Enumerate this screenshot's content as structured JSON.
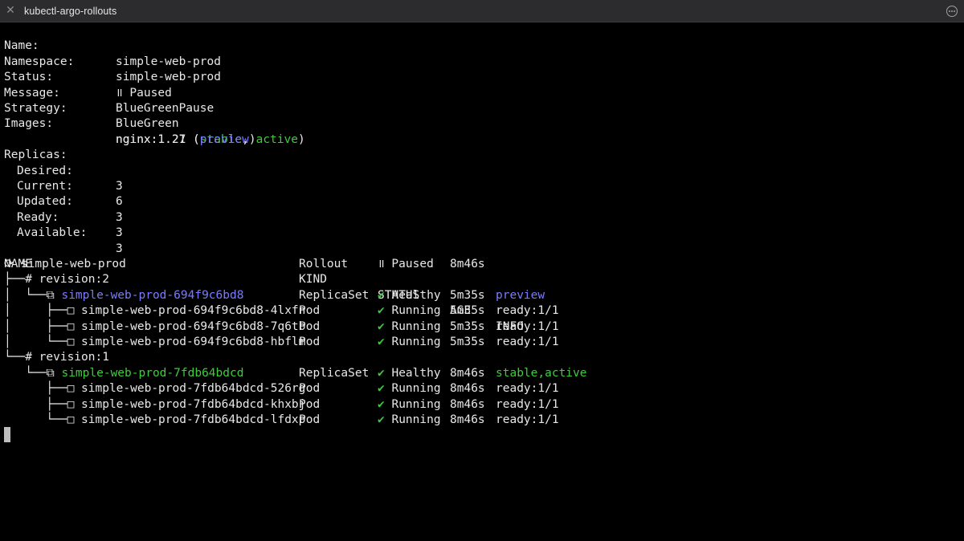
{
  "window": {
    "title": "kubectl-argo-rollouts"
  },
  "summary": {
    "name_label": "Name:",
    "name_value": "simple-web-prod",
    "namespace_label": "Namespace:",
    "namespace_value": "simple-web-prod",
    "status_label": "Status:",
    "status_value": "॥ Paused",
    "message_label": "Message:",
    "message_value": "BlueGreenPause",
    "strategy_label": "Strategy:",
    "strategy_value": "BlueGreen",
    "images_label": "Images:",
    "image1_name": "nginx:1.21",
    "image1_open": " (",
    "image1_tag_stable": "stable",
    "image1_sep": ", ",
    "image1_tag_active": "active",
    "image1_close": ")",
    "image2_name": "nginx:1.27",
    "image2_open": " (",
    "image2_tag_preview": "preview",
    "image2_close": ")"
  },
  "replicas": {
    "label": "Replicas:",
    "desired_label": "Desired:",
    "desired_value": "3",
    "current_label": "Current:",
    "current_value": "6",
    "updated_label": "Updated:",
    "updated_value": "3",
    "ready_label": "Ready:",
    "ready_value": "3",
    "available_label": "Available:",
    "available_value": "3"
  },
  "tree": {
    "headers": {
      "name": "NAME",
      "kind": "KIND",
      "status": "STATUS",
      "age": "AGE",
      "info": "INFO"
    },
    "rows": [
      {
        "prefix": "⟳ ",
        "name": "simple-web-prod",
        "kind": "Rollout",
        "status": "॥ Paused",
        "age": "8m46s",
        "info": "",
        "name_color": "white",
        "info_color": "white"
      },
      {
        "prefix": "├──# ",
        "name": "revision:2",
        "kind": "",
        "status": "",
        "age": "",
        "info": "",
        "name_color": "white",
        "info_color": "white"
      },
      {
        "prefix": "│  └──⧉ ",
        "name": "simple-web-prod-694f9c6bd8",
        "kind": "ReplicaSet",
        "status": "✔ Healthy",
        "age": "5m35s",
        "info": "preview",
        "name_color": "blue",
        "info_color": "blue"
      },
      {
        "prefix": "│     ├──□ ",
        "name": "simple-web-prod-694f9c6bd8-4lxfn",
        "kind": "Pod",
        "status": "✔ Running",
        "age": "5m35s",
        "info": "ready:1/1",
        "name_color": "white",
        "info_color": "white"
      },
      {
        "prefix": "│     ├──□ ",
        "name": "simple-web-prod-694f9c6bd8-7q6tb",
        "kind": "Pod",
        "status": "✔ Running",
        "age": "5m35s",
        "info": "ready:1/1",
        "name_color": "white",
        "info_color": "white"
      },
      {
        "prefix": "│     └──□ ",
        "name": "simple-web-prod-694f9c6bd8-hbflm",
        "kind": "Pod",
        "status": "✔ Running",
        "age": "5m35s",
        "info": "ready:1/1",
        "name_color": "white",
        "info_color": "white"
      },
      {
        "prefix": "└──# ",
        "name": "revision:1",
        "kind": "",
        "status": "",
        "age": "",
        "info": "",
        "name_color": "white",
        "info_color": "white"
      },
      {
        "prefix": "   └──⧉ ",
        "name": "simple-web-prod-7fdb64bdcd",
        "kind": "ReplicaSet",
        "status": "✔ Healthy",
        "age": "8m46s",
        "info": "stable,active",
        "name_color": "green",
        "info_color": "green"
      },
      {
        "prefix": "      ├──□ ",
        "name": "simple-web-prod-7fdb64bdcd-526rg",
        "kind": "Pod",
        "status": "✔ Running",
        "age": "8m46s",
        "info": "ready:1/1",
        "name_color": "white",
        "info_color": "white"
      },
      {
        "prefix": "      ├──□ ",
        "name": "simple-web-prod-7fdb64bdcd-khxbj",
        "kind": "Pod",
        "status": "✔ Running",
        "age": "8m46s",
        "info": "ready:1/1",
        "name_color": "white",
        "info_color": "white"
      },
      {
        "prefix": "      └──□ ",
        "name": "simple-web-prod-7fdb64bdcd-lfdxp",
        "kind": "Pod",
        "status": "✔ Running",
        "age": "8m46s",
        "info": "ready:1/1",
        "name_color": "white",
        "info_color": "white"
      }
    ]
  },
  "colors": {
    "background": "#000000",
    "foreground": "#e8e8e8",
    "blue": "#7b7bff",
    "green": "#3ccc3c",
    "tab_bar": "#2c2c2e"
  }
}
